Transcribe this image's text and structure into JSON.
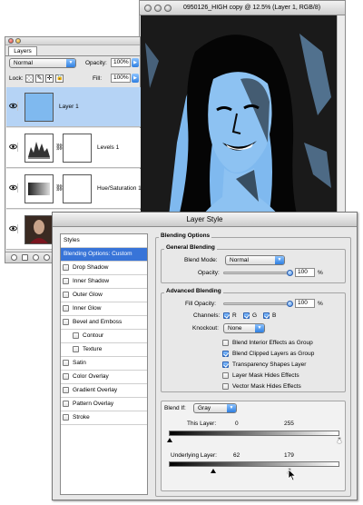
{
  "document": {
    "title": "0950126_HIGH copy @ 12.5% (Layer 1, RGB/8)"
  },
  "layers_palette": {
    "tab_label": "Layers",
    "blend_mode": "Normal",
    "opacity_label": "Opacity:",
    "opacity_value": "100%",
    "lock_label": "Lock:",
    "fill_label": "Fill:",
    "fill_value": "100%",
    "layers": [
      {
        "name": "Layer 1",
        "selected": true
      },
      {
        "name": "Levels 1",
        "selected": false
      },
      {
        "name": "Hue/Saturation 1",
        "selected": false
      },
      {
        "name": "",
        "selected": false
      }
    ]
  },
  "layer_style": {
    "title": "Layer Style",
    "styles": {
      "header": "Styles",
      "items": [
        {
          "label": "Blending Options: Custom",
          "active": true
        },
        {
          "label": "Drop Shadow"
        },
        {
          "label": "Inner Shadow"
        },
        {
          "label": "Outer Glow"
        },
        {
          "label": "Inner Glow"
        },
        {
          "label": "Bevel and Emboss"
        },
        {
          "label": "Contour"
        },
        {
          "label": "Texture"
        },
        {
          "label": "Satin"
        },
        {
          "label": "Color Overlay"
        },
        {
          "label": "Gradient Overlay"
        },
        {
          "label": "Pattern Overlay"
        },
        {
          "label": "Stroke"
        }
      ]
    },
    "blending_options": {
      "title": "Blending Options",
      "general": {
        "title": "General Blending",
        "blend_mode_label": "Blend Mode:",
        "blend_mode": "Normal",
        "opacity_label": "Opacity:",
        "opacity_value": "100",
        "percent": "%"
      },
      "advanced": {
        "title": "Advanced Blending",
        "fill_opacity_label": "Fill Opacity:",
        "fill_opacity_value": "100",
        "percent": "%",
        "channels_label": "Channels:",
        "channels": [
          "R",
          "G",
          "B"
        ],
        "knockout_label": "Knockout:",
        "knockout_value": "None",
        "options": [
          {
            "label": "Blend Interior Effects as Group",
            "checked": false
          },
          {
            "label": "Blend Clipped Layers as Group",
            "checked": true
          },
          {
            "label": "Transparency Shapes Layer",
            "checked": true
          },
          {
            "label": "Layer Mask Hides Effects",
            "checked": false
          },
          {
            "label": "Vector Mask Hides Effects",
            "checked": false
          }
        ]
      },
      "blend_if": {
        "label": "Blend If:",
        "value": "Gray",
        "this_layer_label": "This Layer:",
        "this_layer_low": "0",
        "this_layer_high": "255",
        "underlying_label": "Underlying Layer:",
        "underlying_low": "62",
        "underlying_high": "179"
      }
    }
  }
}
